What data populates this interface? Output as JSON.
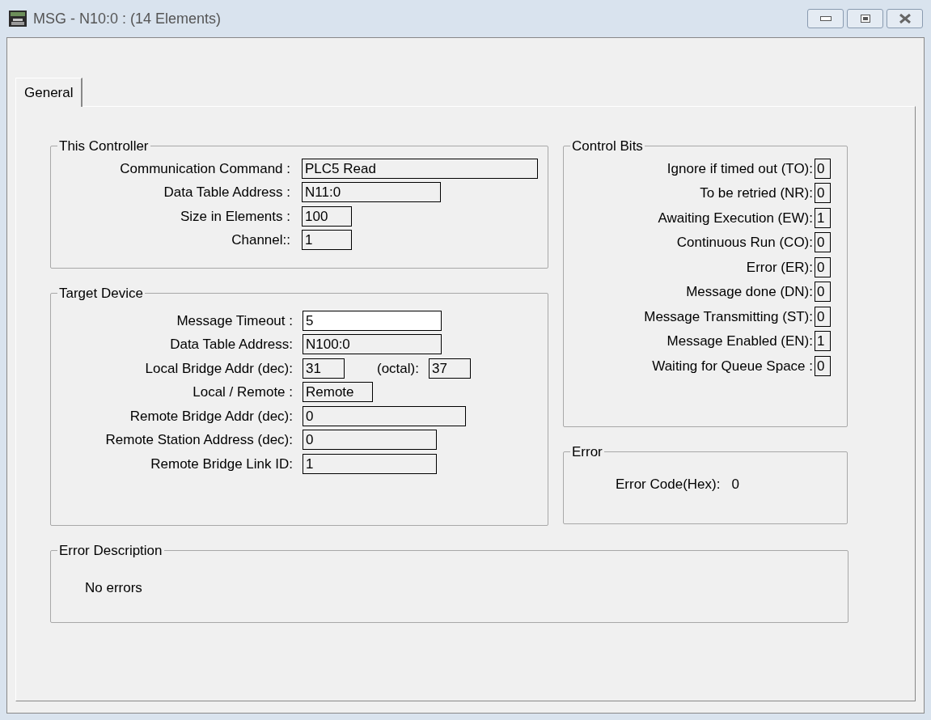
{
  "window": {
    "title": "MSG - N10:0 : (14 Elements)"
  },
  "tabs": [
    {
      "label": "General",
      "selected": true
    }
  ],
  "this_controller": {
    "title": "This Controller",
    "fields": [
      {
        "label": "Communication Command :",
        "value": "PLC5 Read",
        "editable": false
      },
      {
        "label": "Data Table Address :",
        "value": "N11:0",
        "editable": false
      },
      {
        "label": "Size in Elements :",
        "value": "100",
        "editable": false
      },
      {
        "label": "Channel::",
        "value": "1",
        "editable": false
      }
    ]
  },
  "target_device": {
    "title": "Target Device",
    "fields": [
      {
        "label": "Message Timeout :",
        "value": "5",
        "editable": true
      },
      {
        "label": "Data Table Address:",
        "value": "N100:0",
        "editable": false
      },
      {
        "label": "Local Bridge Addr (dec):",
        "value": "31",
        "editable": false,
        "extra_label": "(octal):",
        "extra_value": "37"
      },
      {
        "label": "Local / Remote :",
        "value": "Remote",
        "editable": false
      },
      {
        "label": "Remote Bridge Addr (dec):",
        "value": "0",
        "editable": false
      },
      {
        "label": "Remote Station Address (dec):",
        "value": "0",
        "editable": false
      },
      {
        "label": "Remote Bridge Link ID:",
        "value": "1",
        "editable": false
      }
    ]
  },
  "control_bits": {
    "title": "Control Bits",
    "bits": [
      {
        "label": "Ignore if timed out (TO):",
        "value": "0"
      },
      {
        "label": "To be retried (NR):",
        "value": "0"
      },
      {
        "label": "Awaiting Execution (EW):",
        "value": "1"
      },
      {
        "label": "Continuous Run (CO):",
        "value": "0"
      },
      {
        "label": "Error (ER):",
        "value": "0"
      },
      {
        "label": "Message done (DN):",
        "value": "0"
      },
      {
        "label": "Message Transmitting (ST):",
        "value": "0"
      },
      {
        "label": "Message Enabled (EN):",
        "value": "1"
      },
      {
        "label": "Waiting for Queue Space :",
        "value": "0"
      }
    ]
  },
  "error": {
    "title": "Error",
    "label": "Error Code(Hex):",
    "value": "0"
  },
  "error_description": {
    "title": "Error Description",
    "text": "No errors"
  }
}
